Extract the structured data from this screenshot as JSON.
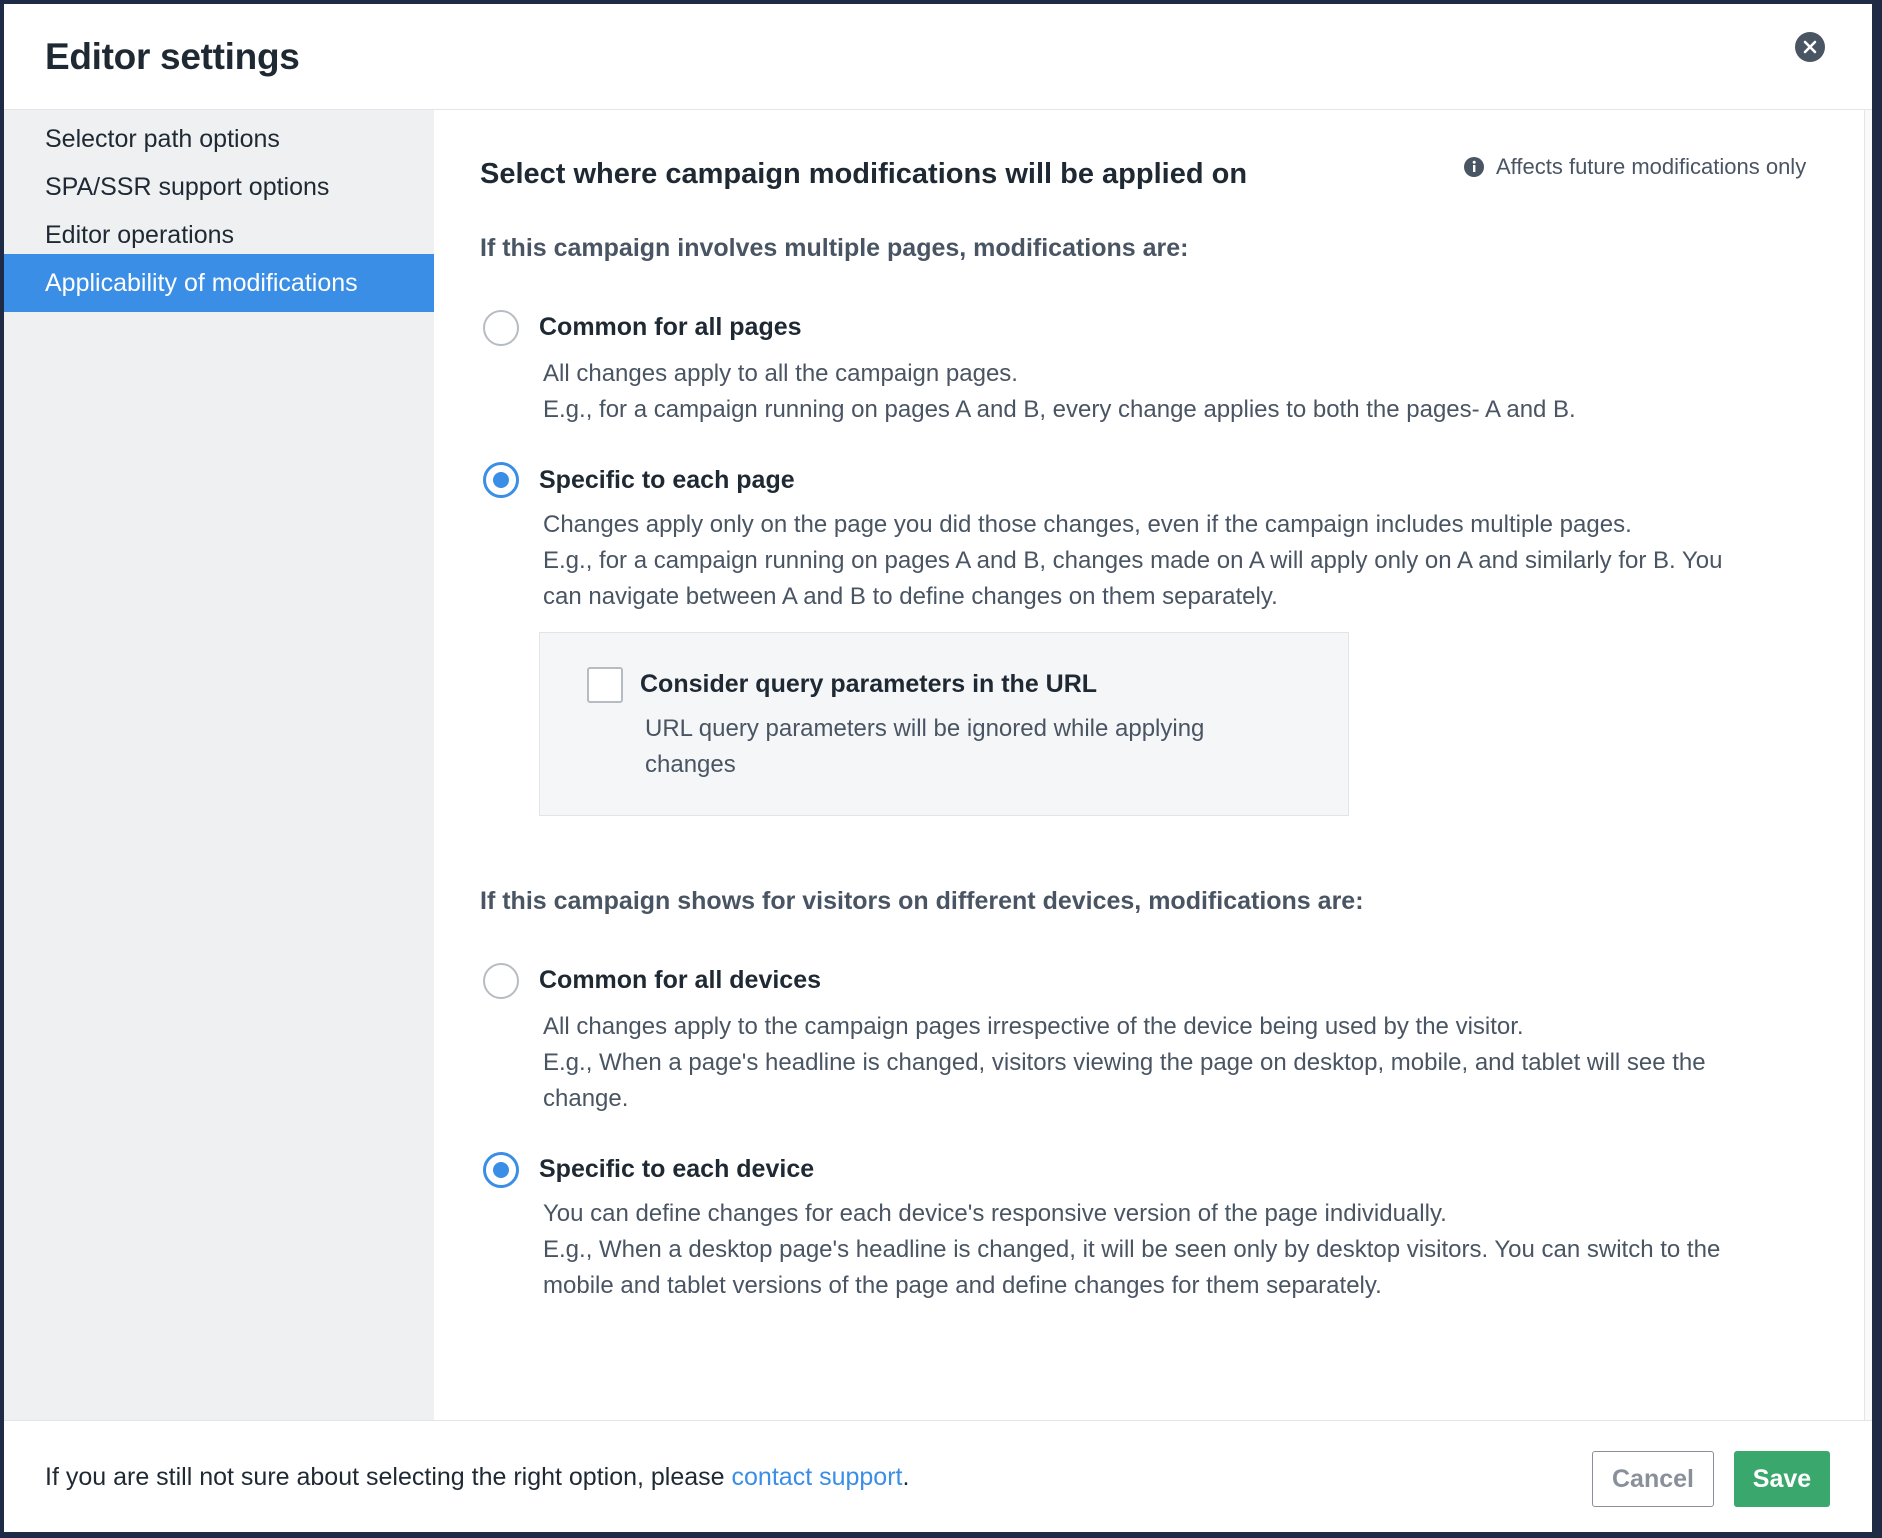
{
  "dialog": {
    "title": "Editor settings",
    "close_icon": "close-icon"
  },
  "sidebar": {
    "items": [
      {
        "label": "Selector path options",
        "active": false
      },
      {
        "label": "SPA/SSR support options",
        "active": false
      },
      {
        "label": "Editor operations",
        "active": false
      },
      {
        "label": "Applicability of modifications",
        "active": true
      }
    ]
  },
  "main": {
    "section_title": "Select where campaign modifications will be applied on",
    "note": "Affects future modifications only",
    "note_icon": "info-icon",
    "pages_group": {
      "title": "If this campaign involves multiple pages, modifications are:",
      "options": [
        {
          "label": "Common for all pages",
          "checked": false,
          "desc": [
            "All changes apply to all the campaign pages.",
            "E.g., for a campaign running on pages A and B, every change applies to both the pages- A and B."
          ]
        },
        {
          "label": "Specific to each page",
          "checked": true,
          "desc": [
            "Changes apply only on the page you did those changes, even if the campaign includes multiple pages.",
            "E.g., for a campaign running on pages A and B, changes made on A will apply only on A and similarly for B. You",
            "can navigate between A and B to define changes on them separately."
          ]
        }
      ],
      "query_params": {
        "label": "Consider query parameters in the URL",
        "checked": false,
        "desc": [
          "URL query parameters will be ignored while applying",
          "changes"
        ]
      }
    },
    "devices_group": {
      "title": "If this campaign shows for visitors on different devices, modifications are:",
      "options": [
        {
          "label": "Common for all devices",
          "checked": false,
          "desc": [
            "All changes apply to the campaign pages irrespective of the device being used by the visitor.",
            "E.g., When a page's headline is changed, visitors viewing the page on desktop, mobile, and tablet will see the",
            "change."
          ]
        },
        {
          "label": "Specific to each device",
          "checked": true,
          "desc": [
            "You can define changes for each device's responsive version of the page individually.",
            "E.g., When a desktop page's headline is changed, it will be seen only by desktop visitors. You can switch to the",
            "mobile and tablet versions of the page and define changes for them separately."
          ]
        }
      ]
    }
  },
  "footer": {
    "text_before": "If you are still not sure about selecting the right option, please ",
    "link": "contact support",
    "text_after": ".",
    "cancel_label": "Cancel",
    "save_label": "Save"
  },
  "colors": {
    "accent": "#3a8ee6",
    "save": "#3aa76d",
    "sidebar_bg": "#eef0f2"
  }
}
